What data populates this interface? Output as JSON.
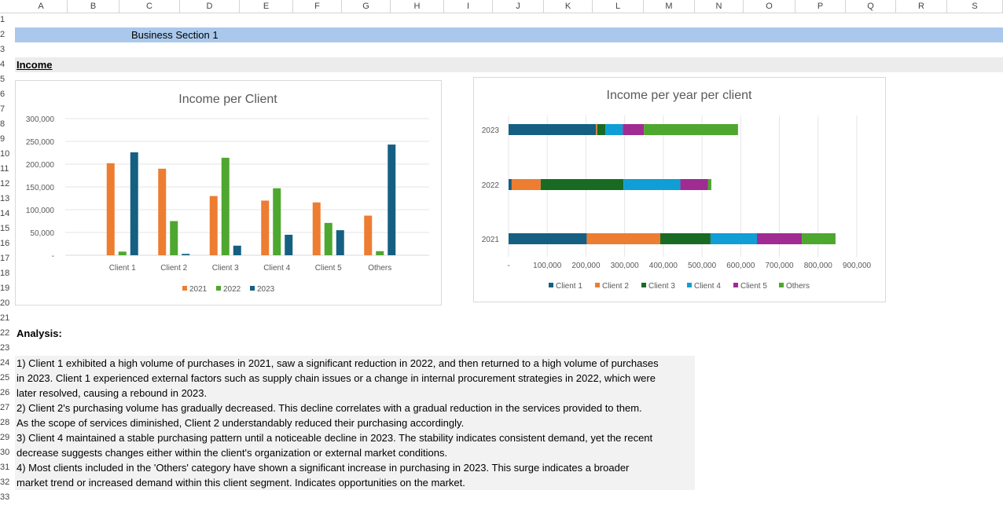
{
  "columns": [
    "A",
    "B",
    "C",
    "D",
    "E",
    "F",
    "G",
    "H",
    "I",
    "J",
    "K",
    "L",
    "M",
    "N",
    "O",
    "P",
    "Q",
    "R",
    "S"
  ],
  "rows": [
    "1",
    "2",
    "3",
    "4",
    "5",
    "6",
    "7",
    "8",
    "9",
    "10",
    "11",
    "12",
    "13",
    "14",
    "15",
    "16",
    "17",
    "18",
    "19",
    "20",
    "21",
    "22",
    "23",
    "24",
    "25",
    "26",
    "27",
    "28",
    "29",
    "30",
    "31",
    "32",
    "33"
  ],
  "sheet": {
    "section_title": "Business Section 1",
    "income_heading": "Income",
    "analysis_heading": "Analysis:",
    "analysis_lines": [
      "1) Client 1 exhibited a high volume of purchases in 2021, saw a significant reduction in 2022, and then returned to a high volume of purchases",
      "in 2023. Client 1 experienced external factors such as supply chain issues or a change in internal procurement strategies in 2022, which were",
      "later resolved, causing a rebound in 2023.",
      "2) Client 2's purchasing volume has gradually decreased. This decline correlates with a gradual reduction in the services provided to them.",
      "As the scope of services diminished, Client 2 understandably reduced their purchasing accordingly.",
      "3) Client 4 maintained a stable purchasing pattern until a noticeable decline in 2023. The stability indicates consistent demand, yet the recent",
      "decrease suggests changes either within the client's organization or external market conditions.",
      "4) Most clients included in the 'Others' category have shown a significant increase in purchasing in 2023. This surge indicates a broader",
      "market trend or increased demand within this client segment. Indicates opportunities on the market."
    ]
  },
  "chart_data": [
    {
      "type": "bar",
      "title": "Income per Client",
      "categories": [
        "Client 1",
        "Client 2",
        "Client 3",
        "Client 4",
        "Client 5",
        "Others"
      ],
      "series": [
        {
          "name": "2021",
          "color": "#ed7d31",
          "values": [
            202000,
            190000,
            130000,
            120000,
            116000,
            87000
          ]
        },
        {
          "name": "2022",
          "color": "#4ea72e",
          "values": [
            8000,
            75000,
            214000,
            147000,
            71000,
            9000
          ]
        },
        {
          "name": "2023",
          "color": "#156082",
          "values": [
            226000,
            3000,
            21000,
            45000,
            55000,
            243000
          ]
        }
      ],
      "ylim": [
        0,
        300000
      ],
      "yticks": [
        "300,000",
        "250,000",
        "200,000",
        "150,000",
        "100,000",
        "50,000",
        "-"
      ],
      "grid": true,
      "legend": "bottom"
    },
    {
      "type": "bar",
      "orientation": "horizontal",
      "stacked": true,
      "title": "Income per year per client",
      "categories": [
        "2023",
        "2022",
        "2021"
      ],
      "series": [
        {
          "name": "Client 1",
          "color": "#156082",
          "values": [
            226000,
            8000,
            202000
          ]
        },
        {
          "name": "Client 2",
          "color": "#ed7d31",
          "values": [
            3000,
            75000,
            190000
          ]
        },
        {
          "name": "Client 3",
          "color": "#196b24",
          "values": [
            21000,
            214000,
            130000
          ]
        },
        {
          "name": "Client 4",
          "color": "#0f9ed5",
          "values": [
            45000,
            147000,
            120000
          ]
        },
        {
          "name": "Client 5",
          "color": "#a02b93",
          "values": [
            55000,
            71000,
            116000
          ]
        },
        {
          "name": "Others",
          "color": "#4ea72e",
          "values": [
            243000,
            9000,
            87000
          ]
        }
      ],
      "xlim": [
        0,
        900000
      ],
      "xticks": [
        "-",
        "100,000",
        "200,000",
        "300,000",
        "400,000",
        "500,000",
        "600,000",
        "700,000",
        "800,000",
        "900,000"
      ],
      "grid": true,
      "legend": "bottom"
    }
  ]
}
